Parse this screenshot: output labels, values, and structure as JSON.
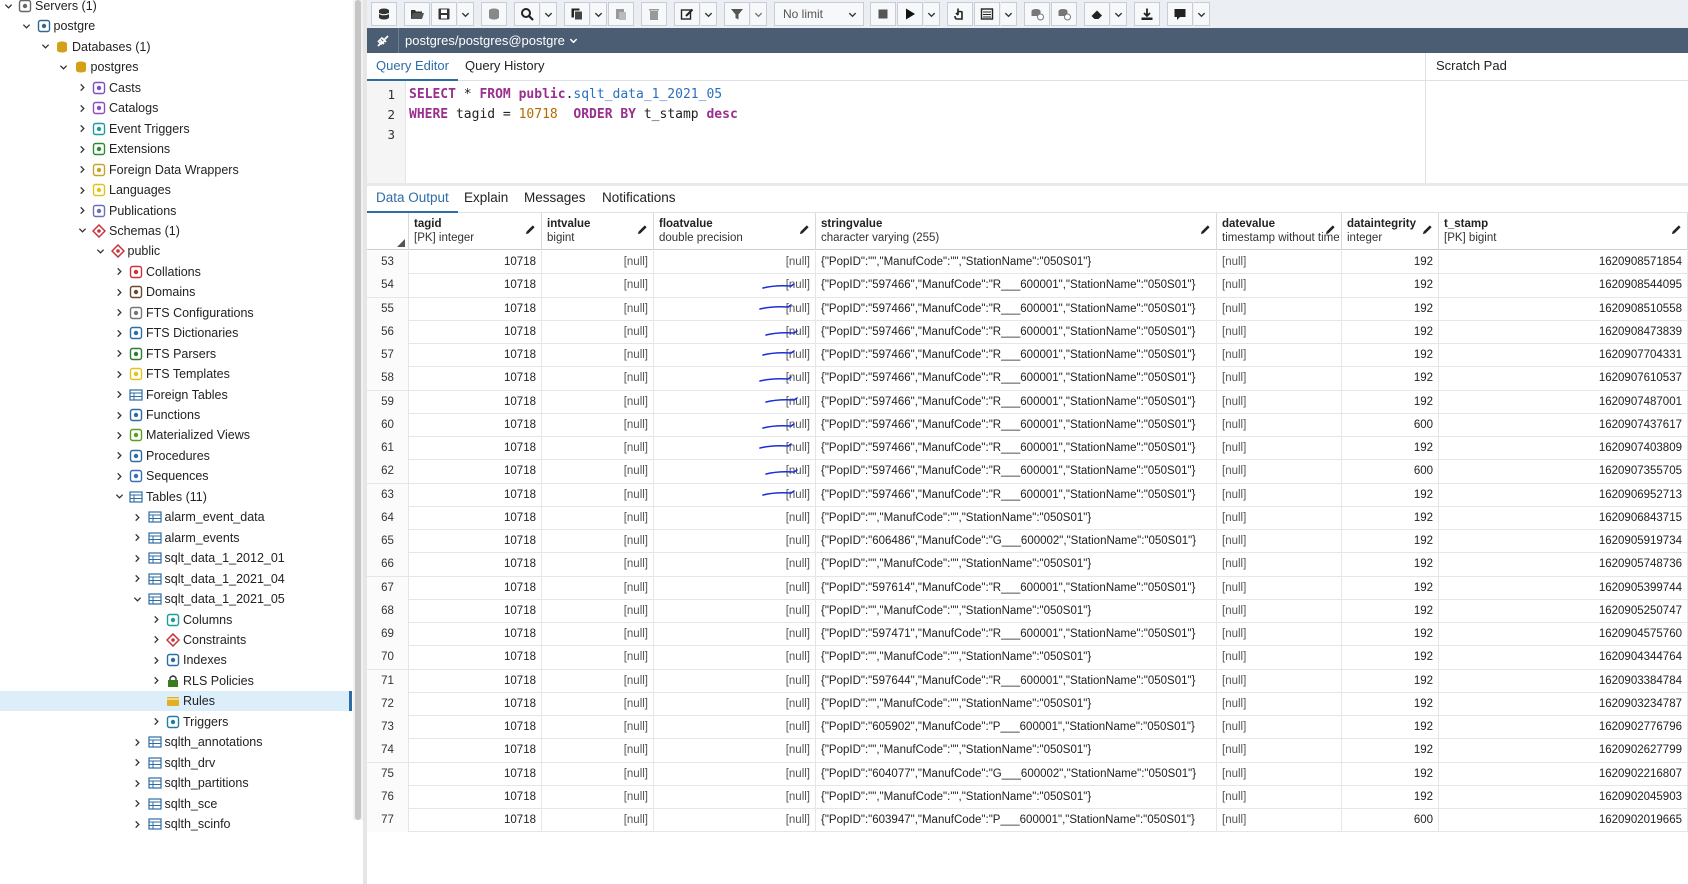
{
  "tree": {
    "items": [
      {
        "label": "Servers (1)",
        "icon": "servers-icon",
        "level": 0,
        "expanded": true
      },
      {
        "label": "postgre",
        "icon": "server-icon",
        "level": 1,
        "expanded": true
      },
      {
        "label": "Databases (1)",
        "icon": "databases-icon",
        "level": 2,
        "expanded": true
      },
      {
        "label": "postgres",
        "icon": "database-icon",
        "level": 3,
        "expanded": true
      },
      {
        "label": "Casts",
        "icon": "casts-icon",
        "level": 4,
        "expanded": false
      },
      {
        "label": "Catalogs",
        "icon": "catalogs-icon",
        "level": 4,
        "expanded": false
      },
      {
        "label": "Event Triggers",
        "icon": "event-triggers-icon",
        "level": 4,
        "expanded": false
      },
      {
        "label": "Extensions",
        "icon": "extensions-icon",
        "level": 4,
        "expanded": false
      },
      {
        "label": "Foreign Data Wrappers",
        "icon": "foreign-data-wrappers-icon",
        "level": 4,
        "expanded": false
      },
      {
        "label": "Languages",
        "icon": "languages-icon",
        "level": 4,
        "expanded": false
      },
      {
        "label": "Publications",
        "icon": "publications-icon",
        "level": 4,
        "expanded": false
      },
      {
        "label": "Schemas (1)",
        "icon": "schemas-icon",
        "level": 4,
        "expanded": true
      },
      {
        "label": "public",
        "icon": "schema-icon",
        "level": 5,
        "expanded": true
      },
      {
        "label": "Collations",
        "icon": "collations-icon",
        "level": 6,
        "expanded": false
      },
      {
        "label": "Domains",
        "icon": "domains-icon",
        "level": 6,
        "expanded": false
      },
      {
        "label": "FTS Configurations",
        "icon": "fts-configurations-icon",
        "level": 6,
        "expanded": false
      },
      {
        "label": "FTS Dictionaries",
        "icon": "fts-dictionaries-icon",
        "level": 6,
        "expanded": false
      },
      {
        "label": "FTS Parsers",
        "icon": "fts-parsers-icon",
        "level": 6,
        "expanded": false
      },
      {
        "label": "FTS Templates",
        "icon": "fts-templates-icon",
        "level": 6,
        "expanded": false
      },
      {
        "label": "Foreign Tables",
        "icon": "foreign-tables-icon",
        "level": 6,
        "expanded": false
      },
      {
        "label": "Functions",
        "icon": "functions-icon",
        "level": 6,
        "expanded": false
      },
      {
        "label": "Materialized Views",
        "icon": "materialized-views-icon",
        "level": 6,
        "expanded": false
      },
      {
        "label": "Procedures",
        "icon": "procedures-icon",
        "level": 6,
        "expanded": false
      },
      {
        "label": "Sequences",
        "icon": "sequences-icon",
        "level": 6,
        "expanded": false
      },
      {
        "label": "Tables (11)",
        "icon": "tables-icon",
        "level": 6,
        "expanded": true
      },
      {
        "label": "alarm_event_data",
        "icon": "table-icon",
        "level": 7,
        "expanded": false
      },
      {
        "label": "alarm_events",
        "icon": "table-icon",
        "level": 7,
        "expanded": false
      },
      {
        "label": "sqlt_data_1_2012_01",
        "icon": "table-icon",
        "level": 7,
        "expanded": false
      },
      {
        "label": "sqlt_data_1_2021_04",
        "icon": "table-icon",
        "level": 7,
        "expanded": false
      },
      {
        "label": "sqlt_data_1_2021_05",
        "icon": "table-icon",
        "level": 7,
        "expanded": true
      },
      {
        "label": "Columns",
        "icon": "columns-icon",
        "level": 8,
        "expanded": false
      },
      {
        "label": "Constraints",
        "icon": "constraints-icon",
        "level": 8,
        "expanded": false
      },
      {
        "label": "Indexes",
        "icon": "indexes-icon",
        "level": 8,
        "expanded": false
      },
      {
        "label": "RLS Policies",
        "icon": "rls-policies-icon",
        "level": 8,
        "expanded": false
      },
      {
        "label": "Rules",
        "icon": "rules-icon",
        "level": 8,
        "expanded": null,
        "selected": true
      },
      {
        "label": "Triggers",
        "icon": "triggers-icon",
        "level": 8,
        "expanded": false
      },
      {
        "label": "sqlth_annotations",
        "icon": "table-icon",
        "level": 7,
        "expanded": false
      },
      {
        "label": "sqlth_drv",
        "icon": "table-icon",
        "level": 7,
        "expanded": false
      },
      {
        "label": "sqlth_partitions",
        "icon": "table-icon",
        "level": 7,
        "expanded": false
      },
      {
        "label": "sqlth_sce",
        "icon": "table-icon",
        "level": 7,
        "expanded": false
      },
      {
        "label": "sqlth_scinfo",
        "icon": "table-icon",
        "level": 7,
        "expanded": false
      }
    ]
  },
  "toolbar": {
    "limit_label": "No limit",
    "buttons": [
      "database-icon",
      "open-file-icon",
      "save-icon",
      "save-data-icon",
      "find-icon",
      "copy-icon",
      "paste-row-icon",
      "delete-icon",
      "edit-icon",
      "filter-icon",
      "stop-icon",
      "execute-icon",
      "explain-icon",
      "explain-analyze-icon",
      "commit-icon",
      "rollback-icon",
      "clear-icon",
      "download-icon",
      "macros-icon"
    ]
  },
  "connection": {
    "label": "postgres/postgres@postgre"
  },
  "editor_tabs": {
    "query_editor": "Query Editor",
    "query_history": "Query History",
    "scratch_pad": "Scratch Pad"
  },
  "editor": {
    "line_numbers": [
      "1",
      "2",
      "3"
    ],
    "line1": {
      "kw1": "SELECT",
      "op": " * ",
      "kw2": "FROM",
      "schema": "public",
      "dot": ".",
      "table": "sqlt_data_1_2021_05"
    },
    "line2": {
      "kw1": "WHERE",
      "col": " tagid = ",
      "num": "10718",
      "kw2": "ORDER BY",
      "col2": " t_stamp ",
      "kw3": "desc"
    }
  },
  "output_tabs": {
    "data_output": "Data Output",
    "explain": "Explain",
    "messages": "Messages",
    "notifications": "Notifications"
  },
  "grid": {
    "columns": [
      {
        "name": "tagid",
        "type": "[PK] integer"
      },
      {
        "name": "intvalue",
        "type": "bigint"
      },
      {
        "name": "floatvalue",
        "type": "double precision"
      },
      {
        "name": "stringvalue",
        "type": "character varying (255)"
      },
      {
        "name": "datevalue",
        "type": "timestamp without time zone"
      },
      {
        "name": "dataintegrity",
        "type": "integer"
      },
      {
        "name": "t_stamp",
        "type": "[PK] bigint"
      }
    ],
    "rows": [
      {
        "n": "53",
        "tagid": "10718",
        "intvalue": "[null]",
        "floatvalue": "[null]",
        "stringvalue": "{\"PopID\":\"\",\"ManufCode\":\"\",\"StationName\":\"050S01\"}",
        "datevalue": "[null]",
        "dataintegrity": "192",
        "t_stamp": "1620908571854"
      },
      {
        "n": "54",
        "tagid": "10718",
        "intvalue": "[null]",
        "floatvalue": "[null]",
        "stringvalue": "{\"PopID\":\"597466\",\"ManufCode\":\"R___600001\",\"StationName\":\"050S01\"}",
        "datevalue": "[null]",
        "dataintegrity": "192",
        "t_stamp": "1620908544095"
      },
      {
        "n": "55",
        "tagid": "10718",
        "intvalue": "[null]",
        "floatvalue": "[null]",
        "stringvalue": "{\"PopID\":\"597466\",\"ManufCode\":\"R___600001\",\"StationName\":\"050S01\"}",
        "datevalue": "[null]",
        "dataintegrity": "192",
        "t_stamp": "1620908510558"
      },
      {
        "n": "56",
        "tagid": "10718",
        "intvalue": "[null]",
        "floatvalue": "[null]",
        "stringvalue": "{\"PopID\":\"597466\",\"ManufCode\":\"R___600001\",\"StationName\":\"050S01\"}",
        "datevalue": "[null]",
        "dataintegrity": "192",
        "t_stamp": "1620908473839"
      },
      {
        "n": "57",
        "tagid": "10718",
        "intvalue": "[null]",
        "floatvalue": "[null]",
        "stringvalue": "{\"PopID\":\"597466\",\"ManufCode\":\"R___600001\",\"StationName\":\"050S01\"}",
        "datevalue": "[null]",
        "dataintegrity": "192",
        "t_stamp": "1620907704331"
      },
      {
        "n": "58",
        "tagid": "10718",
        "intvalue": "[null]",
        "floatvalue": "[null]",
        "stringvalue": "{\"PopID\":\"597466\",\"ManufCode\":\"R___600001\",\"StationName\":\"050S01\"}",
        "datevalue": "[null]",
        "dataintegrity": "192",
        "t_stamp": "1620907610537"
      },
      {
        "n": "59",
        "tagid": "10718",
        "intvalue": "[null]",
        "floatvalue": "[null]",
        "stringvalue": "{\"PopID\":\"597466\",\"ManufCode\":\"R___600001\",\"StationName\":\"050S01\"}",
        "datevalue": "[null]",
        "dataintegrity": "192",
        "t_stamp": "1620907487001"
      },
      {
        "n": "60",
        "tagid": "10718",
        "intvalue": "[null]",
        "floatvalue": "[null]",
        "stringvalue": "{\"PopID\":\"597466\",\"ManufCode\":\"R___600001\",\"StationName\":\"050S01\"}",
        "datevalue": "[null]",
        "dataintegrity": "600",
        "t_stamp": "1620907437617"
      },
      {
        "n": "61",
        "tagid": "10718",
        "intvalue": "[null]",
        "floatvalue": "[null]",
        "stringvalue": "{\"PopID\":\"597466\",\"ManufCode\":\"R___600001\",\"StationName\":\"050S01\"}",
        "datevalue": "[null]",
        "dataintegrity": "192",
        "t_stamp": "1620907403809"
      },
      {
        "n": "62",
        "tagid": "10718",
        "intvalue": "[null]",
        "floatvalue": "[null]",
        "stringvalue": "{\"PopID\":\"597466\",\"ManufCode\":\"R___600001\",\"StationName\":\"050S01\"}",
        "datevalue": "[null]",
        "dataintegrity": "600",
        "t_stamp": "1620907355705"
      },
      {
        "n": "63",
        "tagid": "10718",
        "intvalue": "[null]",
        "floatvalue": "[null]",
        "stringvalue": "{\"PopID\":\"597466\",\"ManufCode\":\"R___600001\",\"StationName\":\"050S01\"}",
        "datevalue": "[null]",
        "dataintegrity": "192",
        "t_stamp": "1620906952713"
      },
      {
        "n": "64",
        "tagid": "10718",
        "intvalue": "[null]",
        "floatvalue": "[null]",
        "stringvalue": "{\"PopID\":\"\",\"ManufCode\":\"\",\"StationName\":\"050S01\"}",
        "datevalue": "[null]",
        "dataintegrity": "192",
        "t_stamp": "1620906843715"
      },
      {
        "n": "65",
        "tagid": "10718",
        "intvalue": "[null]",
        "floatvalue": "[null]",
        "stringvalue": "{\"PopID\":\"606486\",\"ManufCode\":\"G___600002\",\"StationName\":\"050S01\"}",
        "datevalue": "[null]",
        "dataintegrity": "192",
        "t_stamp": "1620905919734"
      },
      {
        "n": "66",
        "tagid": "10718",
        "intvalue": "[null]",
        "floatvalue": "[null]",
        "stringvalue": "{\"PopID\":\"\",\"ManufCode\":\"\",\"StationName\":\"050S01\"}",
        "datevalue": "[null]",
        "dataintegrity": "192",
        "t_stamp": "1620905748736"
      },
      {
        "n": "67",
        "tagid": "10718",
        "intvalue": "[null]",
        "floatvalue": "[null]",
        "stringvalue": "{\"PopID\":\"597614\",\"ManufCode\":\"R___600001\",\"StationName\":\"050S01\"}",
        "datevalue": "[null]",
        "dataintegrity": "192",
        "t_stamp": "1620905399744"
      },
      {
        "n": "68",
        "tagid": "10718",
        "intvalue": "[null]",
        "floatvalue": "[null]",
        "stringvalue": "{\"PopID\":\"\",\"ManufCode\":\"\",\"StationName\":\"050S01\"}",
        "datevalue": "[null]",
        "dataintegrity": "192",
        "t_stamp": "1620905250747"
      },
      {
        "n": "69",
        "tagid": "10718",
        "intvalue": "[null]",
        "floatvalue": "[null]",
        "stringvalue": "{\"PopID\":\"597471\",\"ManufCode\":\"R___600001\",\"StationName\":\"050S01\"}",
        "datevalue": "[null]",
        "dataintegrity": "192",
        "t_stamp": "1620904575760"
      },
      {
        "n": "70",
        "tagid": "10718",
        "intvalue": "[null]",
        "floatvalue": "[null]",
        "stringvalue": "{\"PopID\":\"\",\"ManufCode\":\"\",\"StationName\":\"050S01\"}",
        "datevalue": "[null]",
        "dataintegrity": "192",
        "t_stamp": "1620904344764"
      },
      {
        "n": "71",
        "tagid": "10718",
        "intvalue": "[null]",
        "floatvalue": "[null]",
        "stringvalue": "{\"PopID\":\"597644\",\"ManufCode\":\"R___600001\",\"StationName\":\"050S01\"}",
        "datevalue": "[null]",
        "dataintegrity": "192",
        "t_stamp": "1620903384784"
      },
      {
        "n": "72",
        "tagid": "10718",
        "intvalue": "[null]",
        "floatvalue": "[null]",
        "stringvalue": "{\"PopID\":\"\",\"ManufCode\":\"\",\"StationName\":\"050S01\"}",
        "datevalue": "[null]",
        "dataintegrity": "192",
        "t_stamp": "1620903234787"
      },
      {
        "n": "73",
        "tagid": "10718",
        "intvalue": "[null]",
        "floatvalue": "[null]",
        "stringvalue": "{\"PopID\":\"605902\",\"ManufCode\":\"P___600001\",\"StationName\":\"050S01\"}",
        "datevalue": "[null]",
        "dataintegrity": "192",
        "t_stamp": "1620902776796"
      },
      {
        "n": "74",
        "tagid": "10718",
        "intvalue": "[null]",
        "floatvalue": "[null]",
        "stringvalue": "{\"PopID\":\"\",\"ManufCode\":\"\",\"StationName\":\"050S01\"}",
        "datevalue": "[null]",
        "dataintegrity": "192",
        "t_stamp": "1620902627799"
      },
      {
        "n": "75",
        "tagid": "10718",
        "intvalue": "[null]",
        "floatvalue": "[null]",
        "stringvalue": "{\"PopID\":\"604077\",\"ManufCode\":\"G___600002\",\"StationName\":\"050S01\"}",
        "datevalue": "[null]",
        "dataintegrity": "192",
        "t_stamp": "1620902216807"
      },
      {
        "n": "76",
        "tagid": "10718",
        "intvalue": "[null]",
        "floatvalue": "[null]",
        "stringvalue": "{\"PopID\":\"\",\"ManufCode\":\"\",\"StationName\":\"050S01\"}",
        "datevalue": "[null]",
        "dataintegrity": "192",
        "t_stamp": "1620902045903"
      },
      {
        "n": "77",
        "tagid": "10718",
        "intvalue": "[null]",
        "floatvalue": "[null]",
        "stringvalue": "{\"PopID\":\"603947\",\"ManufCode\":\"P___600001\",\"StationName\":\"050S01\"}",
        "datevalue": "[null]",
        "dataintegrity": "600",
        "t_stamp": "1620902019665"
      }
    ],
    "pen_mark_rows": [
      "54",
      "55",
      "56",
      "57",
      "58",
      "59",
      "60",
      "61",
      "62",
      "63"
    ]
  },
  "colors": {
    "accent": "#2d6da6",
    "conn_bar": "#4a5d72",
    "keyword": "#9a2f8e",
    "number": "#b36b00",
    "pen_mark": "#1a2fd8"
  }
}
